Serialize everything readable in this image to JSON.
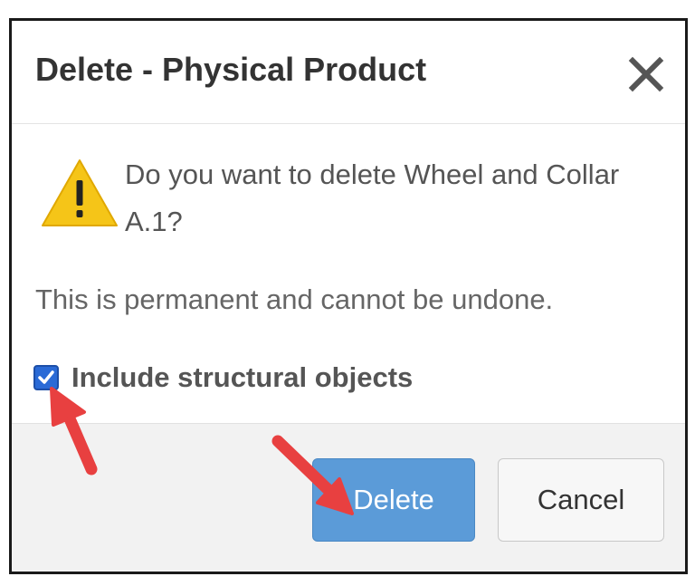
{
  "dialog": {
    "title": "Delete - Physical Product",
    "close_icon": "close-icon",
    "warning_icon": "warning-triangle-icon",
    "question": "Do you want to delete Wheel and Collar A.1?",
    "permanent_notice": "This is permanent and cannot be undone.",
    "include_structural": {
      "label": "Include structural objects",
      "checked": true
    },
    "buttons": {
      "delete_label": "Delete",
      "cancel_label": "Cancel"
    }
  },
  "colors": {
    "primary_button": "#5b9bd8",
    "checkbox_checked": "#2a6ad6",
    "warning_fill": "#f5c518",
    "annotation_arrow": "#e84040"
  }
}
